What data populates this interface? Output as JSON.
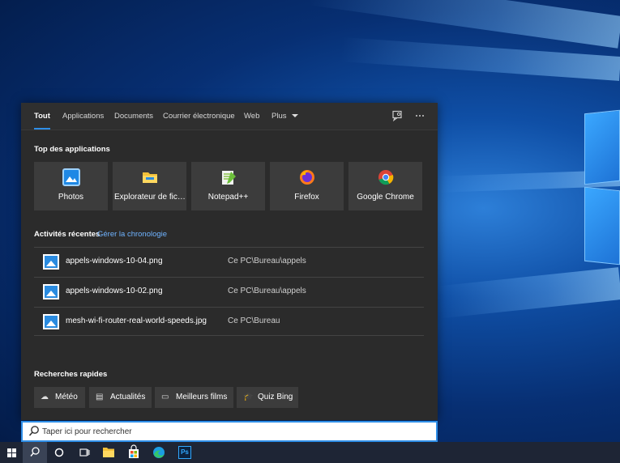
{
  "search_panel": {
    "tabs": [
      {
        "label": "Tout",
        "active": true
      },
      {
        "label": "Applications"
      },
      {
        "label": "Documents"
      },
      {
        "label": "Courrier électronique"
      },
      {
        "label": "Web"
      },
      {
        "label": "Plus"
      }
    ],
    "feedback_icon": "feedback-icon",
    "more_icon": "ellipsis-icon",
    "top_apps": {
      "title": "Top des applications",
      "apps": [
        {
          "label": "Photos",
          "icon": "photos-icon"
        },
        {
          "label": "Explorateur de fic…",
          "icon": "file-explorer-icon"
        },
        {
          "label": "Notepad++",
          "icon": "notepadpp-icon"
        },
        {
          "label": "Firefox",
          "icon": "firefox-icon"
        },
        {
          "label": "Google Chrome",
          "icon": "chrome-icon"
        }
      ]
    },
    "recent": {
      "title": "Activités récentes",
      "manage_link": "Gérer la chronologie",
      "items": [
        {
          "name": "appels-windows-10-04.png",
          "path": "Ce PC\\Bureau\\appels"
        },
        {
          "name": "appels-windows-10-02.png",
          "path": "Ce PC\\Bureau\\appels"
        },
        {
          "name": "mesh-wi-fi-router-real-world-speeds.jpg",
          "path": "Ce PC\\Bureau"
        }
      ]
    },
    "quick_searches": {
      "title": "Recherches rapides",
      "items": [
        {
          "label": "Météo",
          "icon": "weather-icon"
        },
        {
          "label": "Actualités",
          "icon": "news-icon"
        },
        {
          "label": "Meilleurs films",
          "icon": "movie-icon"
        },
        {
          "label": "Quiz Bing",
          "icon": "quiz-icon"
        }
      ]
    }
  },
  "search_box": {
    "placeholder": "Taper ici pour rechercher"
  },
  "taskbar": {
    "items": [
      "windows-start-icon",
      "search-icon",
      "cortana-icon",
      "task-view-icon",
      "file-explorer-icon",
      "store-icon",
      "edge-icon",
      "photoshop-icon"
    ],
    "photoshop_label": "Ps"
  },
  "colors": {
    "accent": "#2f8fe8",
    "panel_bg": "#2b2b2b",
    "tile_bg": "#3c3c3c",
    "link": "#6fb3ff"
  }
}
